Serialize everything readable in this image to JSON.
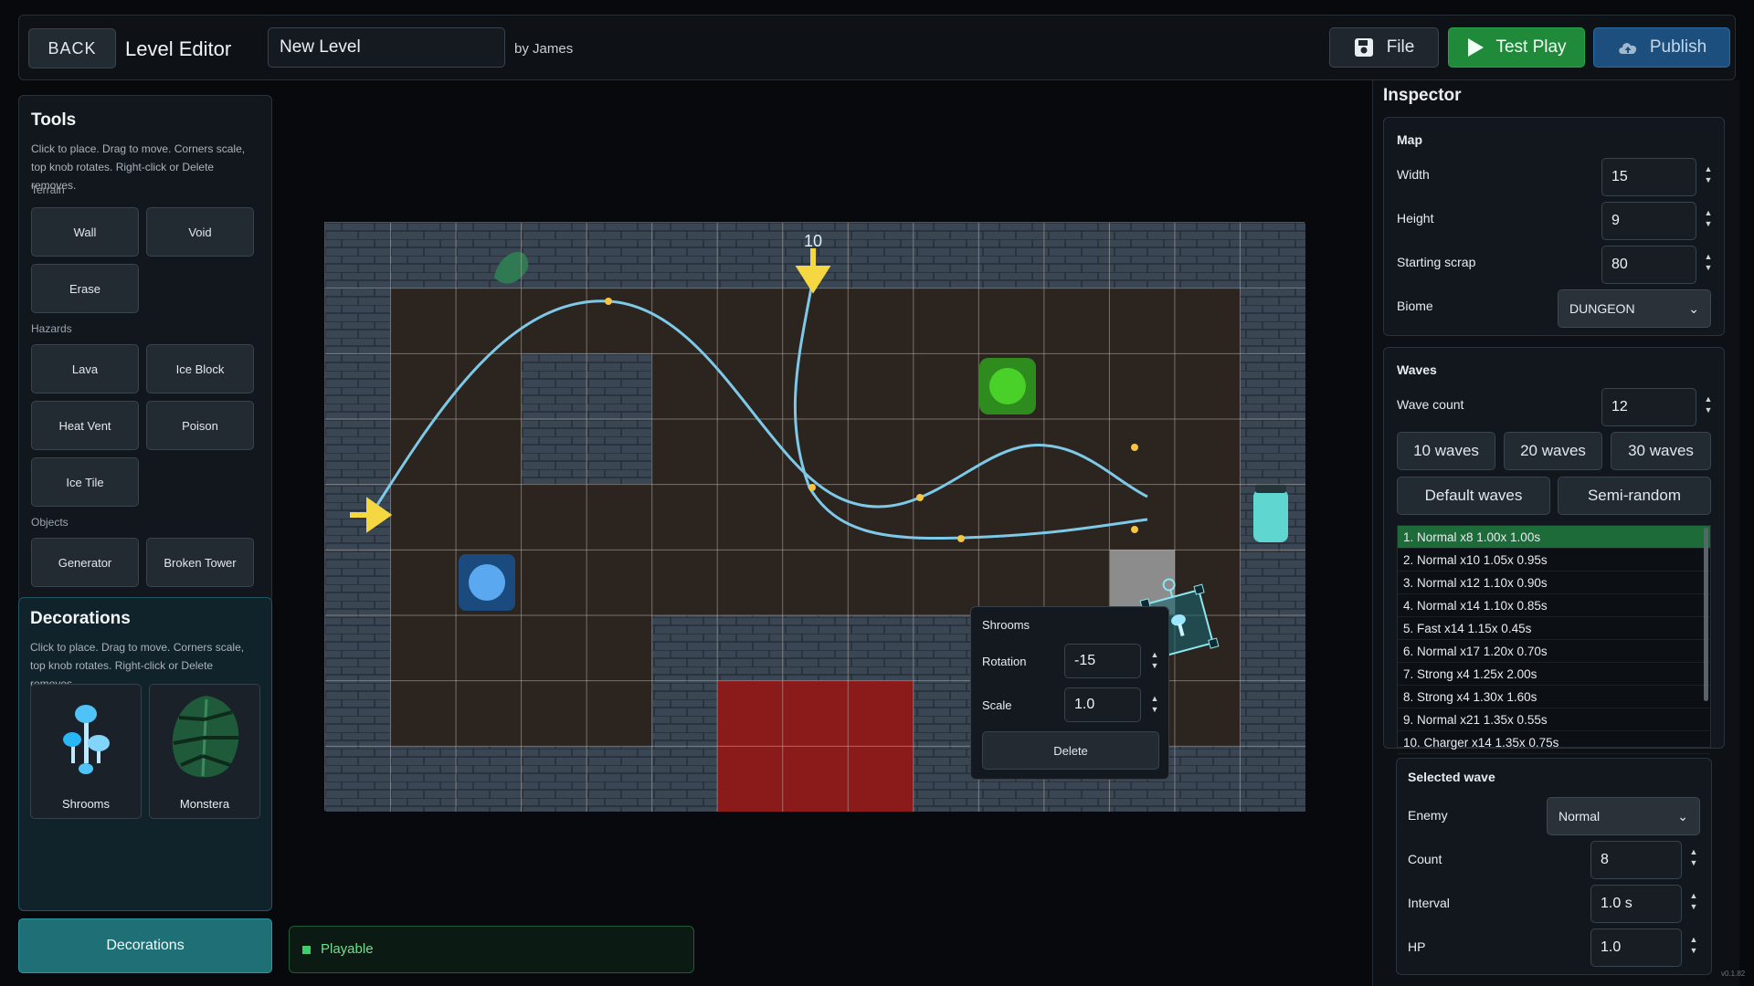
{
  "topbar": {
    "back_label": "BACK",
    "title": "Level Editor",
    "level_name": "New Level",
    "byline": "by James",
    "file_label": "File",
    "test_play_label": "Test Play",
    "publish_label": "Publish"
  },
  "tools": {
    "title": "Tools",
    "hint": "Click to place. Drag to move. Corners scale, top knob rotates. Right-click or Delete removes.",
    "sections": {
      "terrain": "Terrain",
      "hazards": "Hazards",
      "objects": "Objects"
    },
    "terrain": [
      "Wall",
      "Void",
      "Erase"
    ],
    "hazards": [
      "Lava",
      "Ice Block",
      "Heat Vent",
      "Poison",
      "Ice Tile"
    ],
    "objects": [
      "Generator",
      "Broken Tower"
    ]
  },
  "decorations": {
    "title": "Decorations",
    "hint": "Click to place. Drag to move. Corners scale, top knob rotates. Right-click or Delete removes.",
    "items": [
      "Shrooms",
      "Monstera"
    ],
    "tab_label": "Decorations"
  },
  "status": {
    "label": "Playable",
    "color": "#3ecf6a"
  },
  "board": {
    "cols": 15,
    "rows": 9,
    "spawn_count": "10"
  },
  "popup": {
    "title": "Shrooms",
    "rotation_label": "Rotation",
    "rotation_value": "-15",
    "scale_label": "Scale",
    "scale_value": "1.0",
    "delete_label": "Delete"
  },
  "inspector": {
    "title": "Inspector",
    "map": {
      "title": "Map",
      "width_label": "Width",
      "width_value": "15",
      "height_label": "Height",
      "height_value": "9",
      "scrap_label": "Starting scrap",
      "scrap_value": "80",
      "biome_label": "Biome",
      "biome_value": "DUNGEON"
    },
    "waves": {
      "title": "Waves",
      "count_label": "Wave count",
      "count_value": "12",
      "presets": [
        "10 waves",
        "20 waves",
        "30 waves"
      ],
      "modes": [
        "Default waves",
        "Semi-random"
      ],
      "list": [
        "1. Normal x8 1.00x 1.00s",
        "2. Normal x10 1.05x 0.95s",
        "3. Normal x12 1.10x 0.90s",
        "4. Normal x14 1.10x 0.85s",
        "5. Fast x14 1.15x 0.45s",
        "6. Normal x17 1.20x 0.70s",
        "7. Strong x4 1.25x 2.00s",
        "8. Strong x4 1.30x 1.60s",
        "9. Normal x21 1.35x 0.55s",
        "10. Charger x14 1.35x 0.75s"
      ]
    },
    "selected": {
      "title": "Selected wave",
      "enemy_label": "Enemy",
      "enemy_value": "Normal",
      "count_label": "Count",
      "count_value": "8",
      "interval_label": "Interval",
      "interval_value": "1.0 s",
      "hp_label": "HP",
      "hp_value": "1.0"
    },
    "version": "v0.1.82"
  },
  "colors": {
    "path": "#7ec8e8",
    "lava": "#8b1a1a",
    "accent_green": "#1e8a3a",
    "accent_blue": "#1d4f7e",
    "teal": "#1e6f76"
  }
}
